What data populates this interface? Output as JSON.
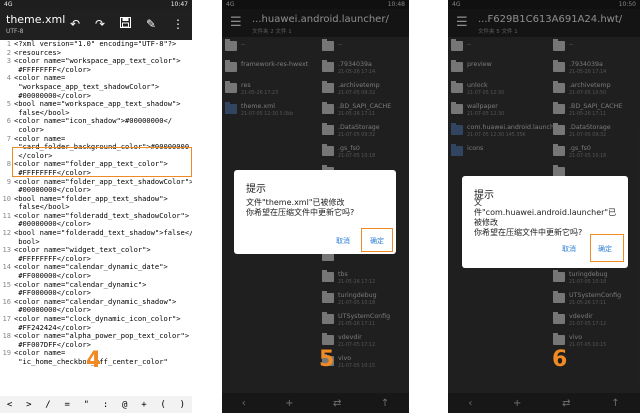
{
  "panel1": {
    "status_left": "4G",
    "status_right": "10:47",
    "title": "theme.xml",
    "subtitle": "UTF-8",
    "step_number": "4",
    "code_lines": [
      {
        "n": "1",
        "text": "<?xml version=\"1.0\" encoding=\"UTF-8\"?>"
      },
      {
        "n": "2",
        "text": "<resources>"
      },
      {
        "n": "3",
        "text": "<color name=\"workspace_app_text_color\">"
      },
      {
        "n": "",
        "text": " #FFFFFFFF</color>"
      },
      {
        "n": "4",
        "text": "<color name="
      },
      {
        "n": "",
        "text": " \"workspace_app_text_shadowColor\">"
      },
      {
        "n": "",
        "text": " #00000000</color>"
      },
      {
        "n": "5",
        "text": "<bool name=\"workspace_app_text_shadow\">"
      },
      {
        "n": "",
        "text": " false</bool>"
      },
      {
        "n": "6",
        "text": "<color name=\"icon_shadow\">#00000000</"
      },
      {
        "n": "",
        "text": " color>"
      },
      {
        "n": "7",
        "text": "<color name="
      },
      {
        "n": "",
        "text": " \"card_folder_background_color\">#00000000"
      },
      {
        "n": "",
        "text": " </color>"
      },
      {
        "n": "8",
        "text": "<color name=\"folder_app_text_color\">"
      },
      {
        "n": "",
        "text": " #FFFFFFFF</color>"
      },
      {
        "n": "9",
        "text": "<color name=\"folder_app_text_shadowColor\">"
      },
      {
        "n": "",
        "text": " #00000000</color>"
      },
      {
        "n": "10",
        "text": "<bool name=\"folder_app_text_shadow\">"
      },
      {
        "n": "",
        "text": " false</bool>"
      },
      {
        "n": "11",
        "text": "<color name=\"folderadd_text_shadowColor\">"
      },
      {
        "n": "",
        "text": " #00000000</color>"
      },
      {
        "n": "12",
        "text": "<bool name=\"folderadd_text_shadow\">false</"
      },
      {
        "n": "",
        "text": " bool>"
      },
      {
        "n": "13",
        "text": "<color name=\"widget_text_color\">"
      },
      {
        "n": "",
        "text": " #FFFFFFFF</color>"
      },
      {
        "n": "14",
        "text": "<color name=\"calendar_dynamic_date\">"
      },
      {
        "n": "",
        "text": " #FF000000</color>"
      },
      {
        "n": "15",
        "text": "<color name=\"calendar_dynamic\">"
      },
      {
        "n": "",
        "text": " #FF000000</color>"
      },
      {
        "n": "16",
        "text": "<color name=\"calendar_dynamic_shadow\">"
      },
      {
        "n": "",
        "text": " #00000000</color>"
      },
      {
        "n": "17",
        "text": "<color name=\"clock_dynamic_icon_color\">"
      },
      {
        "n": "",
        "text": " #FF242424</color>"
      },
      {
        "n": "18",
        "text": "<color name=\"alpha_power_pop_text_color\">"
      },
      {
        "n": "",
        "text": " #FF007DFF</color>"
      },
      {
        "n": "19",
        "text": "<color name="
      },
      {
        "n": "",
        "text": " \"ic_home_checkbox_off_center_color\""
      }
    ],
    "keys": [
      "<",
      ">",
      "/",
      "=",
      "\"",
      ":",
      "@",
      "+",
      "(",
      ")"
    ]
  },
  "panel2": {
    "status_left": "4G",
    "status_right": "10:48",
    "title": "...huawei.android.launcher/",
    "subtitle": "文件夹 2  文件 1",
    "step_number": "5",
    "left_items": [
      {
        "name": "..",
        "date": "",
        "type": "folder"
      },
      {
        "name": "framework-res-hwext",
        "date": "",
        "type": "folder"
      },
      {
        "name": "res",
        "date": "21-05-26 17:23",
        "type": "folder"
      },
      {
        "name": "theme.xml",
        "date": "21-07-05 12:30  5.0kb",
        "type": "doc"
      }
    ],
    "right_items": [
      {
        "name": "..",
        "date": ""
      },
      {
        "name": ".7934039a",
        "date": "21-05-26 17:14"
      },
      {
        "name": ".archivetemp",
        "date": "21-07-05 09:32"
      },
      {
        "name": ".BD_SAPI_CACHE",
        "date": "21-05-26 17:11"
      },
      {
        "name": ".DataStorage",
        "date": "21-07-05 09:32"
      },
      {
        "name": ".gs_fs0",
        "date": "21-07-05 10:18"
      },
      {
        "name": "",
        "date": ""
      },
      {
        "name": "",
        "date": ""
      },
      {
        "name": "",
        "date": ""
      },
      {
        "name": "",
        "date": ""
      },
      {
        "name": "",
        "date": ""
      },
      {
        "name": "tbs",
        "date": "21-05-26 17:12"
      },
      {
        "name": "turingdebug",
        "date": "21-07-05 10:18"
      },
      {
        "name": "UTSystemConfig",
        "date": "21-05-26 17:11"
      },
      {
        "name": "vdevdir",
        "date": "21-07-05 17:12"
      },
      {
        "name": "vivo",
        "date": "21-07-05 10:15"
      }
    ],
    "dialog": {
      "title": "提示",
      "message_line1": "文件\"theme.xml\"已被修改",
      "message_line2": "你希望在压缩文件中更新它吗?",
      "cancel": "取消",
      "ok": "确定"
    },
    "bottom_icons": [
      "‹",
      "+",
      "⇄",
      "↑"
    ]
  },
  "panel3": {
    "status_left": "4G",
    "status_right": "10:50",
    "title": "...F629B1C613A691A24.hwt/",
    "subtitle": "文件夹 5  文件 1",
    "step_number": "6",
    "left_items": [
      {
        "name": "..",
        "date": "",
        "type": "folder"
      },
      {
        "name": "preview",
        "date": "",
        "type": "folder"
      },
      {
        "name": "unlock",
        "date": "21-07-05 12:30",
        "type": "folder"
      },
      {
        "name": "wallpaper",
        "date": "21-07-05 12:30",
        "type": "folder"
      },
      {
        "name": "com.huawei.android.launcher",
        "date": "21-07-05 12:30  145.35K",
        "type": "doc"
      },
      {
        "name": "icons",
        "date": "",
        "type": "doc"
      }
    ],
    "right_items": [
      {
        "name": "..",
        "date": ""
      },
      {
        "name": ".7934039a",
        "date": "21-05-26 17:14"
      },
      {
        "name": ".archivetemp",
        "date": "21-07-05 10:50"
      },
      {
        "name": ".BD_SAPI_CACHE",
        "date": "21-05-26 17:11"
      },
      {
        "name": ".DataStorage",
        "date": "21-07-05 09:32"
      },
      {
        "name": ".gs_fs0",
        "date": "21-07-05 10:18"
      },
      {
        "name": "",
        "date": ""
      },
      {
        "name": "",
        "date": ""
      },
      {
        "name": "",
        "date": ""
      },
      {
        "name": "",
        "date": ""
      },
      {
        "name": "",
        "date": ""
      },
      {
        "name": "turingdebug",
        "date": "21-07-05 10:18"
      },
      {
        "name": "UTSystemConfig",
        "date": "21-05-26 17:11"
      },
      {
        "name": "vdevdir",
        "date": "21-07-05 17:12"
      },
      {
        "name": "vivo",
        "date": "21-07-05 10:15"
      }
    ],
    "dialog": {
      "title": "提示",
      "message_line1": "文",
      "message_line2": "件\"com.huawei.android.launcher\"已",
      "message_line3": "被修改",
      "message_line4": "你希望在压缩文件中更新它吗?",
      "cancel": "取消",
      "ok": "确定"
    },
    "bottom_icons": [
      "‹",
      "+",
      "⇄",
      "↑"
    ]
  }
}
